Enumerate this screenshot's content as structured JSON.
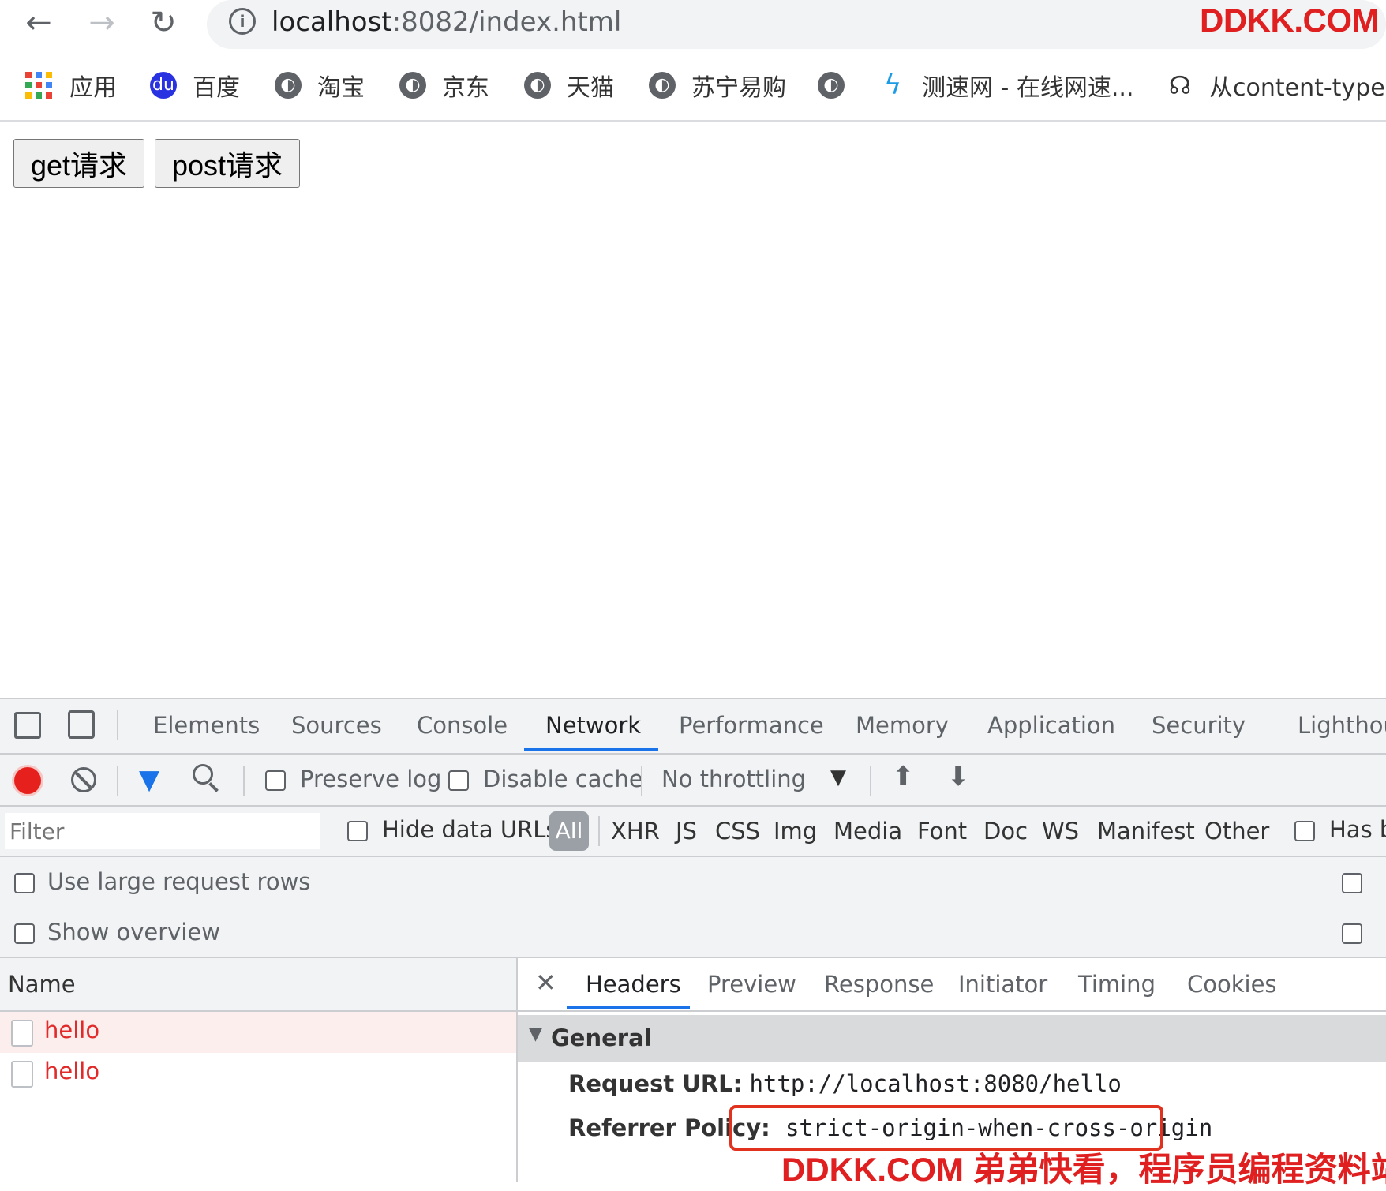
{
  "browser": {
    "url_host": "localhost",
    "url_rest": ":8082/index.html",
    "watermark_top": "DDKK.COM",
    "bookmarks": [
      {
        "label": "应用",
        "icon": "apps-icon"
      },
      {
        "label": "百度",
        "icon": "baidu-icon"
      },
      {
        "label": "淘宝",
        "icon": "globe-icon"
      },
      {
        "label": "京东",
        "icon": "globe-icon"
      },
      {
        "label": "天猫",
        "icon": "globe-icon"
      },
      {
        "label": "苏宁易购",
        "icon": "globe-icon"
      },
      {
        "label": "",
        "icon": "globe-icon"
      },
      {
        "label": "测速网 - 在线网速...",
        "icon": "speedtest-icon"
      },
      {
        "label": "从content-type设",
        "icon": "bookmark-icon"
      }
    ]
  },
  "page": {
    "get_button": "get请求",
    "post_button": "post请求"
  },
  "devtools": {
    "tabs": [
      "Elements",
      "Sources",
      "Console",
      "Network",
      "Performance",
      "Memory",
      "Application",
      "Security",
      "Lighthouse"
    ],
    "active_tab": "Network",
    "toolbar": {
      "preserve_log": "Preserve log",
      "disable_cache": "Disable cache",
      "throttling": "No throttling"
    },
    "filter": {
      "placeholder": "Filter",
      "hide_data_urls": "Hide data URLs",
      "all": "All",
      "types": [
        "XHR",
        "JS",
        "CSS",
        "Img",
        "Media",
        "Font",
        "Doc",
        "WS",
        "Manifest",
        "Other"
      ],
      "has_blocked": "Has b"
    },
    "options": {
      "large_rows": "Use large request rows",
      "show_overview": "Show overview"
    },
    "requests": {
      "header": "Name",
      "rows": [
        "hello",
        "hello"
      ]
    },
    "details": {
      "tabs": [
        "Headers",
        "Preview",
        "Response",
        "Initiator",
        "Timing",
        "Cookies"
      ],
      "active_tab": "Headers",
      "general_title": "General",
      "request_url_key": "Request URL:",
      "request_url_value": "http://localhost:8080/hello",
      "referrer_key": "Referrer Policy:",
      "referrer_value": "strict-origin-when-cross-origin"
    },
    "accent_color": "#1a73e8",
    "request_error_color": "#e12b2b"
  },
  "watermark_bottom": "DDKK.COM 弟弟快看，程序员编程资料站"
}
